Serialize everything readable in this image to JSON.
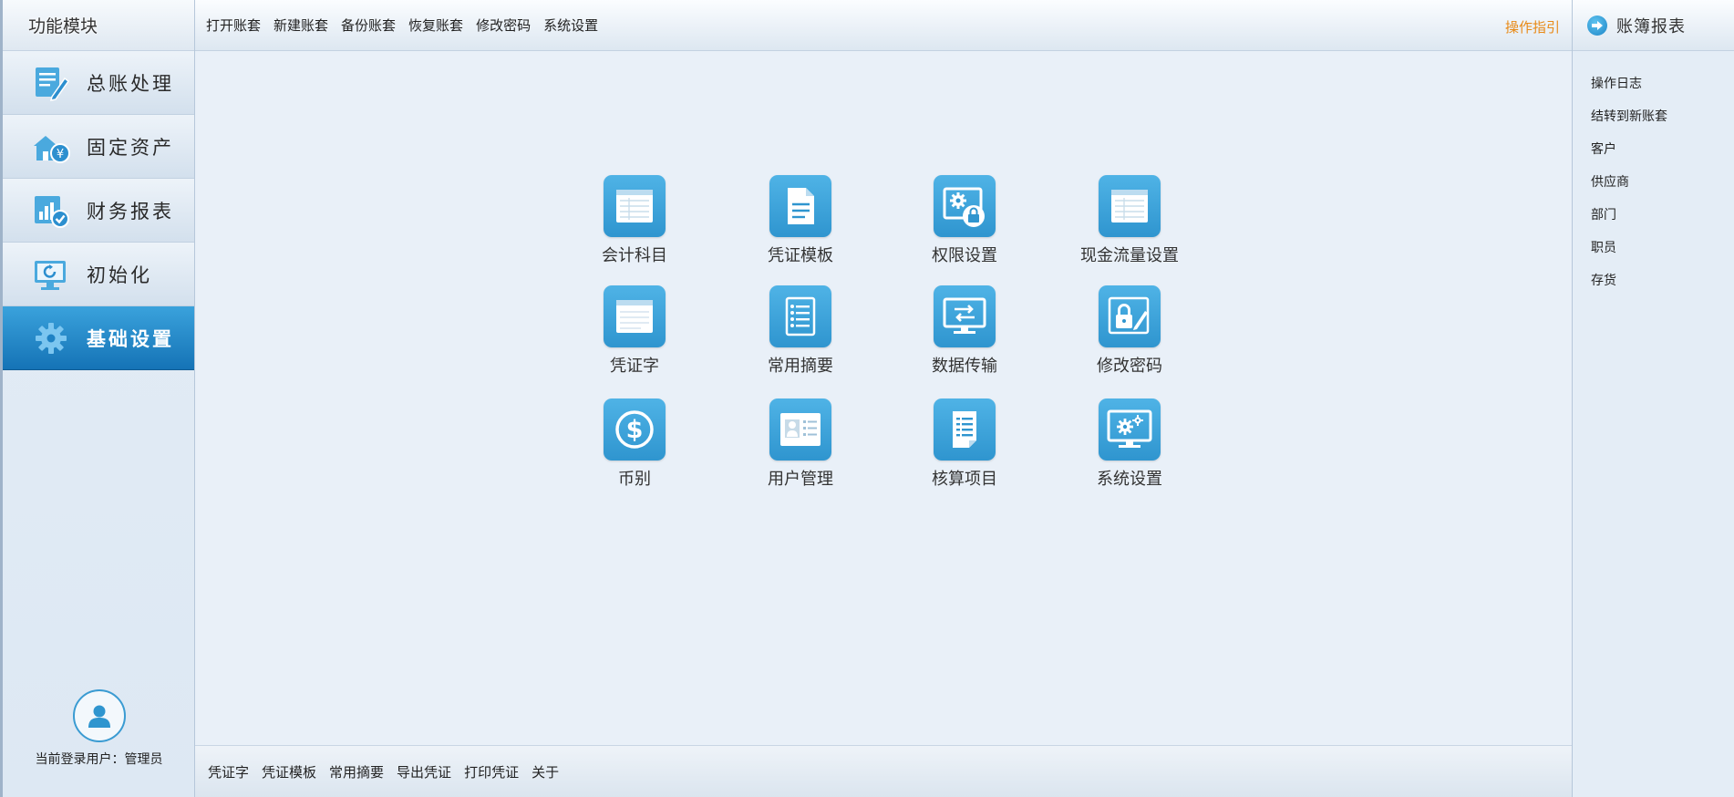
{
  "sidebar": {
    "title": "功能模块",
    "modules": [
      {
        "label": "总账处理",
        "icon": "ledger-edit-icon"
      },
      {
        "label": "固定资产",
        "icon": "fixed-asset-icon"
      },
      {
        "label": "财务报表",
        "icon": "report-chart-icon"
      },
      {
        "label": "初始化",
        "icon": "monitor-refresh-icon"
      },
      {
        "label": "基础设置",
        "icon": "gear-icon",
        "active": true
      }
    ],
    "user": "当前登录用户：管理员"
  },
  "toolbar": {
    "items": [
      "打开账套",
      "新建账套",
      "备份账套",
      "恢复账套",
      "修改密码",
      "系统设置"
    ],
    "guide": "操作指引"
  },
  "tiles": [
    {
      "label": "会计科目",
      "icon": "account-table-icon"
    },
    {
      "label": "凭证模板",
      "icon": "voucher-template-icon"
    },
    {
      "label": "权限设置",
      "icon": "permission-lock-icon"
    },
    {
      "label": "现金流量设置",
      "icon": "cashflow-table-icon"
    },
    {
      "label": "凭证字",
      "icon": "voucher-word-icon"
    },
    {
      "label": "常用摘要",
      "icon": "summary-list-icon"
    },
    {
      "label": "数据传输",
      "icon": "data-transfer-icon"
    },
    {
      "label": "修改密码",
      "icon": "password-lock-icon"
    },
    {
      "label": "币别",
      "icon": "currency-icon"
    },
    {
      "label": "用户管理",
      "icon": "user-card-icon"
    },
    {
      "label": "核算项目",
      "icon": "accounting-item-icon"
    },
    {
      "label": "系统设置",
      "icon": "system-settings-icon"
    }
  ],
  "bottombar": {
    "items": [
      "凭证字",
      "凭证模板",
      "常用摘要",
      "导出凭证",
      "打印凭证",
      "关于"
    ]
  },
  "rightpanel": {
    "title": "账簿报表",
    "items": [
      "操作日志",
      "结转到新账套",
      "客户",
      "供应商",
      "部门",
      "职员",
      "存货"
    ]
  },
  "colors": {
    "accent": "#2f95cf",
    "active_module": "#1f82c4",
    "guide": "#e88a17"
  }
}
